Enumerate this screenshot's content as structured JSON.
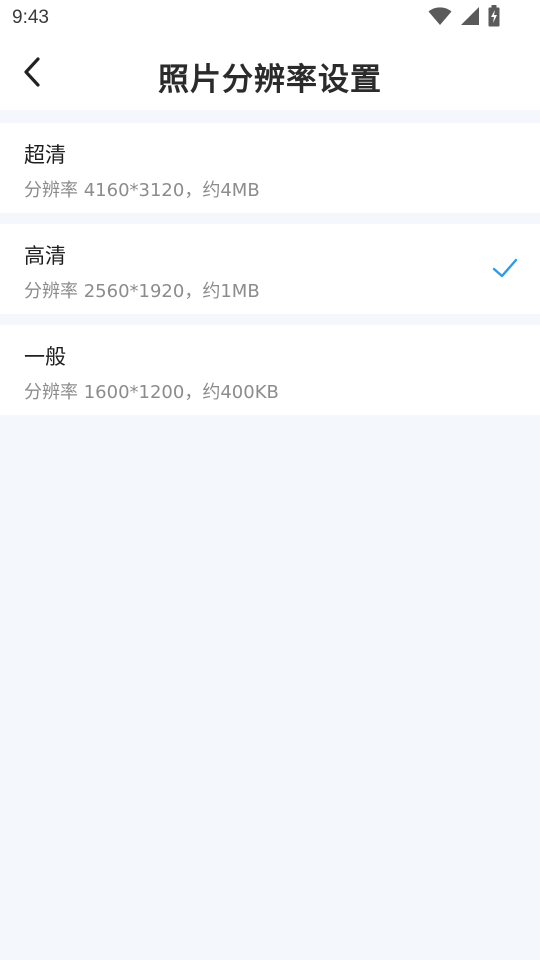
{
  "status_bar": {
    "time": "9:43",
    "icons": [
      "wifi-icon",
      "signal-icon",
      "battery-charging-icon"
    ]
  },
  "header": {
    "back_icon": "chevron-left-icon",
    "title": "照片分辨率设置"
  },
  "options": [
    {
      "title": "超清",
      "description": "分辨率 4160*3120，约4MB",
      "selected": false
    },
    {
      "title": "高清",
      "description": "分辨率 2560*1920，约1MB",
      "selected": true
    },
    {
      "title": "一般",
      "description": "分辨率 1600*1200，约400KB",
      "selected": false
    }
  ],
  "colors": {
    "background": "#f4f8fd",
    "card": "#ffffff",
    "accent_check": "#2f9be6",
    "title_text": "#2b2b2b",
    "secondary_text": "#8c8c8c"
  }
}
